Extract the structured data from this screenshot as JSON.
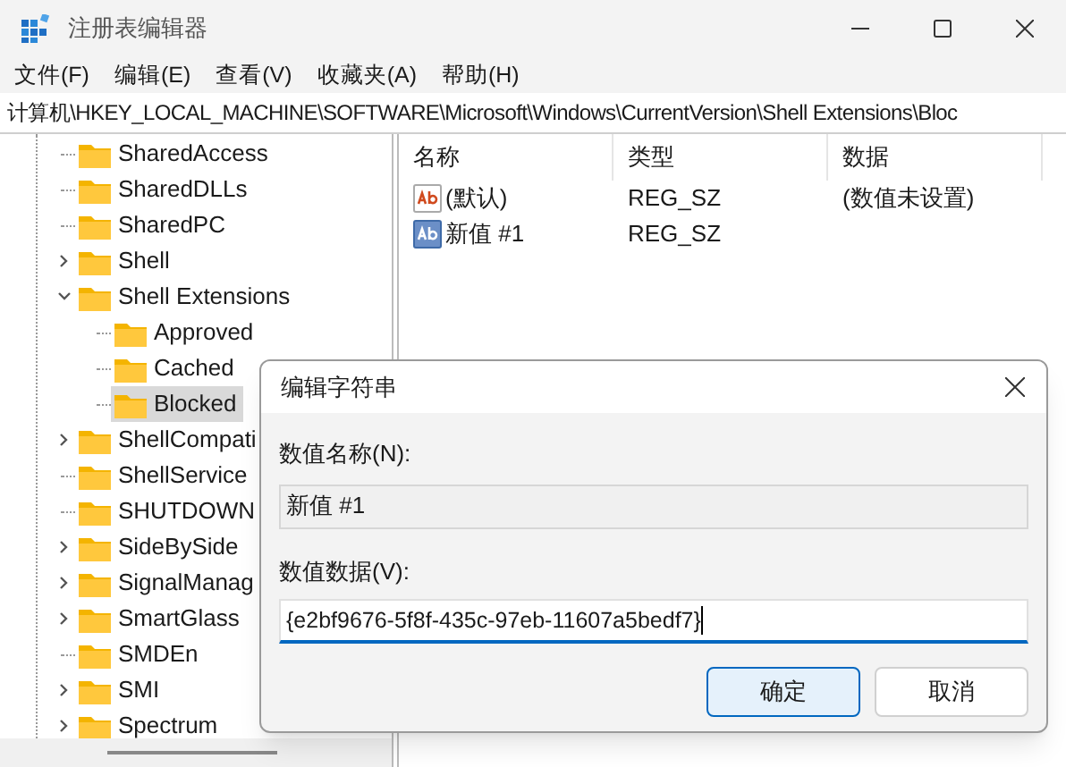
{
  "window": {
    "title": "注册表编辑器"
  },
  "menu": [
    "文件(F)",
    "编辑(E)",
    "查看(V)",
    "收藏夹(A)",
    "帮助(H)"
  ],
  "address": "计算机\\HKEY_LOCAL_MACHINE\\SOFTWARE\\Microsoft\\Windows\\CurrentVersion\\Shell Extensions\\Bloc",
  "tree": {
    "items": [
      {
        "label": "SharedAccess",
        "kind": "leaf",
        "selected": false
      },
      {
        "label": "SharedDLLs",
        "kind": "leaf",
        "selected": false
      },
      {
        "label": "SharedPC",
        "kind": "leaf",
        "selected": false
      },
      {
        "label": "Shell",
        "kind": "branch",
        "expanded": false,
        "selected": false
      },
      {
        "label": "Shell Extensions",
        "kind": "branch",
        "expanded": true,
        "selected": false,
        "children": [
          {
            "label": "Approved",
            "kind": "leaf",
            "selected": false
          },
          {
            "label": "Cached",
            "kind": "leaf",
            "selected": false
          },
          {
            "label": "Blocked",
            "kind": "leaf",
            "selected": true
          }
        ]
      },
      {
        "label": "ShellCompati",
        "kind": "branch",
        "expanded": false,
        "selected": false
      },
      {
        "label": "ShellService",
        "kind": "leaf",
        "selected": false
      },
      {
        "label": "SHUTDOWN",
        "kind": "leaf",
        "selected": false
      },
      {
        "label": "SideBySide",
        "kind": "branch",
        "expanded": false,
        "selected": false
      },
      {
        "label": "SignalManag",
        "kind": "branch",
        "expanded": false,
        "selected": false
      },
      {
        "label": "SmartGlass",
        "kind": "branch",
        "expanded": false,
        "selected": false
      },
      {
        "label": "SMDEn",
        "kind": "leaf",
        "selected": false
      },
      {
        "label": "SMI",
        "kind": "branch",
        "expanded": false,
        "selected": false
      },
      {
        "label": "Spectrum",
        "kind": "branch",
        "expanded": false,
        "selected": false
      }
    ]
  },
  "values": {
    "columns": [
      "名称",
      "类型",
      "数据"
    ],
    "rows": [
      {
        "name": "(默认)",
        "type": "REG_SZ",
        "data": "(数值未设置)",
        "selected": false
      },
      {
        "name": "新值 #1",
        "type": "REG_SZ",
        "selected": true
      }
    ]
  },
  "dialog": {
    "title": "编辑字符串",
    "name_label": "数值名称(N):",
    "name_value": "新值 #1",
    "data_label": "数值数据(V):",
    "data_value": "{e2bf9676-5f8f-435c-97eb-11607a5bedf7}",
    "buttons": [
      {
        "label": "确定",
        "kind": "default"
      },
      {
        "label": "取消",
        "kind": "normal"
      }
    ]
  }
}
